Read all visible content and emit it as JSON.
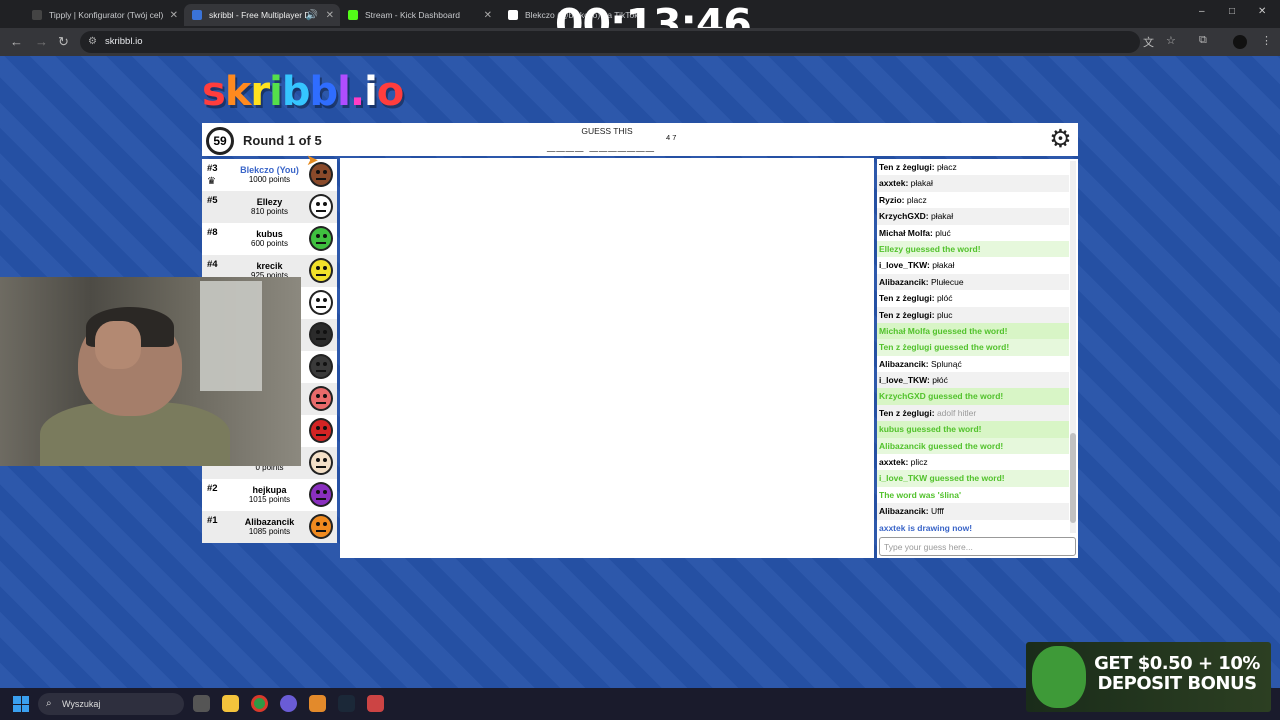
{
  "browser": {
    "tabs": [
      {
        "title": "Tipply | Konfigurator (Twój cel)",
        "favicon_color": "#444444"
      },
      {
        "title": "skribbl - Free Multiplayer Drawing",
        "favicon_color": "#3a73d8",
        "active": true
      },
      {
        "title": "Stream - Kick Dashboard",
        "favicon_color": "#53fc18"
      },
      {
        "title": "Blekczo (@blekczo) na TikToku",
        "favicon_color": "#ffffff"
      }
    ],
    "url": "skribbl.io",
    "window_controls": [
      "–",
      "□",
      "✕"
    ]
  },
  "overlay": {
    "timer": "00:13:46"
  },
  "game": {
    "logo": "skribbl.io",
    "timer_seconds": "59",
    "round_text": "Round 1 of 5",
    "guess_label": "GUESS THIS",
    "hint": "____ _______",
    "hint_lengths": "4 7",
    "players": [
      {
        "rank": "#3",
        "name": "Blekczo (You)",
        "points": "1000 points",
        "you": true,
        "color": "#8a4a2a",
        "crown": true
      },
      {
        "rank": "#5",
        "name": "Ellezy",
        "points": "810 points",
        "color": "#ffffff"
      },
      {
        "rank": "#8",
        "name": "kubus",
        "points": "600 points",
        "color": "#3fbf3f"
      },
      {
        "rank": "#4",
        "name": "krecik",
        "points": "925 points",
        "color": "#f2e12a"
      },
      {
        "rank": "",
        "name": "",
        "points": "",
        "color": "#ffffff"
      },
      {
        "rank": "",
        "name": "",
        "points": "",
        "color": "#2b2b2b"
      },
      {
        "rank": "",
        "name": "",
        "points": "",
        "color": "#3a3a3a"
      },
      {
        "rank": "",
        "name": "",
        "points": "",
        "color": "#e86a6a"
      },
      {
        "rank": "",
        "name": "",
        "points": "",
        "color": "#d42424"
      },
      {
        "rank": "",
        "name": "",
        "points": "0 points",
        "color": "#f3e0c8"
      },
      {
        "rank": "#2",
        "name": "hejkupa",
        "points": "1015 points",
        "color": "#8a2fbf"
      },
      {
        "rank": "#1",
        "name": "Alibazancik",
        "points": "1085 points",
        "color": "#f08a1f"
      }
    ],
    "chat": [
      {
        "user": "Ten z żeglugi",
        "text": "płacz",
        "type": "normal"
      },
      {
        "user": "axxtek",
        "text": "płakał",
        "type": "normal"
      },
      {
        "user": "Ryzio",
        "text": "placz",
        "type": "normal"
      },
      {
        "user": "KrzychGXD",
        "text": "płakał",
        "type": "normal"
      },
      {
        "user": "Michał Molfa",
        "text": "pluć",
        "type": "normal"
      },
      {
        "user": "",
        "text": "Ellezy guessed the word!",
        "type": "green"
      },
      {
        "user": "i_love_TKW",
        "text": "płakał",
        "type": "normal"
      },
      {
        "user": "Alibazancik",
        "text": "Plułecue",
        "type": "normal"
      },
      {
        "user": "Ten z żeglugi",
        "text": "plóć",
        "type": "normal"
      },
      {
        "user": "Ten z żeglugi",
        "text": "pluc",
        "type": "normal"
      },
      {
        "user": "",
        "text": "Michał Molfa guessed the word!",
        "type": "greenbg"
      },
      {
        "user": "",
        "text": "Ten z żeglugi guessed the word!",
        "type": "greenbg"
      },
      {
        "user": "Alibazancik",
        "text": "Splunąć",
        "type": "normal"
      },
      {
        "user": "i_love_TKW",
        "text": "płóć",
        "type": "normal"
      },
      {
        "user": "",
        "text": "KrzychGXD guessed the word!",
        "type": "greenbg"
      },
      {
        "user": "Ten z żeglugi",
        "text": "adolf hitler",
        "type": "grey"
      },
      {
        "user": "",
        "text": "kubus guessed the word!",
        "type": "greenbg"
      },
      {
        "user": "",
        "text": "Alibazancik guessed the word!",
        "type": "greenbg"
      },
      {
        "user": "axxtek",
        "text": "plicz",
        "type": "normal"
      },
      {
        "user": "",
        "text": "i_love_TKW guessed the word!",
        "type": "greenbg"
      },
      {
        "user": "",
        "text": "The word was 'ślina'",
        "type": "green"
      },
      {
        "user": "Alibazancik",
        "text": "Ufff",
        "type": "normal"
      },
      {
        "user": "",
        "text": "axxtek is drawing now!",
        "type": "blue"
      }
    ],
    "chat_placeholder": "Type your guess here..."
  },
  "taskbar": {
    "search_label": "Wyszukaj"
  },
  "ad": {
    "text": "GET $0.50 + 10% DEPOSIT BONUS"
  },
  "colors": {
    "page_bg": "#2653a8",
    "logo_letters": [
      "#ff3d3d",
      "#ff8a1f",
      "#ffe21f",
      "#55e04a",
      "#35c5ff",
      "#2f6dff",
      "#b04dff",
      "#ff3dc5",
      "#ffffff",
      "#ff3d3d"
    ],
    "guessed": "#52c22c",
    "you": "#3a65c8"
  }
}
